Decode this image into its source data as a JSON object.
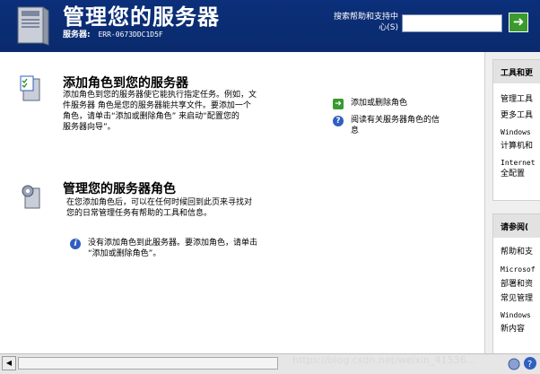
{
  "header": {
    "title": "管理您的服务器",
    "server_label": "服务器:",
    "server_name": "ERR-0673DDC1D5F",
    "search_label_line1": "搜索帮助和支持中",
    "search_label_line2": "心(S)",
    "search_value": "",
    "go_icon": "green-arrow-icon"
  },
  "main": {
    "add_role": {
      "title": "添加角色到您的服务器",
      "description": [
        "添加角色到您的服务器使它能执行指定任务。例如，文",
        "件服务器 角色是您的服务器能共享文件。要添加一个",
        "角色，请单击“添加或删除角色” 来启动“配置您的",
        "服务器向导”。"
      ],
      "actions": [
        {
          "icon": "green-arrow-icon",
          "label": [
            "添加或删除角色"
          ]
        },
        {
          "icon": "help-icon",
          "label": [
            "阅读有关服务器角色的信",
            "息"
          ]
        }
      ]
    },
    "manage_roles": {
      "title": "管理您的服务器角色",
      "description": [
        "在您添加角色后，可以在任何时候回到此页来寻找对",
        "您的日常管理任务有帮助的工具和信息。"
      ],
      "info": [
        "没有添加角色到此服务器。要添加角色，请单击",
        "“添加或删除角色”。"
      ]
    }
  },
  "right_panel": {
    "tools": {
      "title": "工具和更",
      "items": [
        "管理工具",
        "更多工具",
        "Windows",
        "计算机和",
        "Internet",
        "全配置"
      ]
    },
    "see_also": {
      "title": "请参阅(",
      "items": [
        "帮助和支",
        "Microsof",
        "部署和资",
        "常见管理",
        "Windows",
        "新内容"
      ]
    }
  },
  "watermark": "https://blog.csdn.net/weixin_41536...",
  "colors": {
    "header_bg": "#0a2a6c",
    "go_green": "#3a9a2e",
    "help_blue": "#2f5fc0"
  }
}
